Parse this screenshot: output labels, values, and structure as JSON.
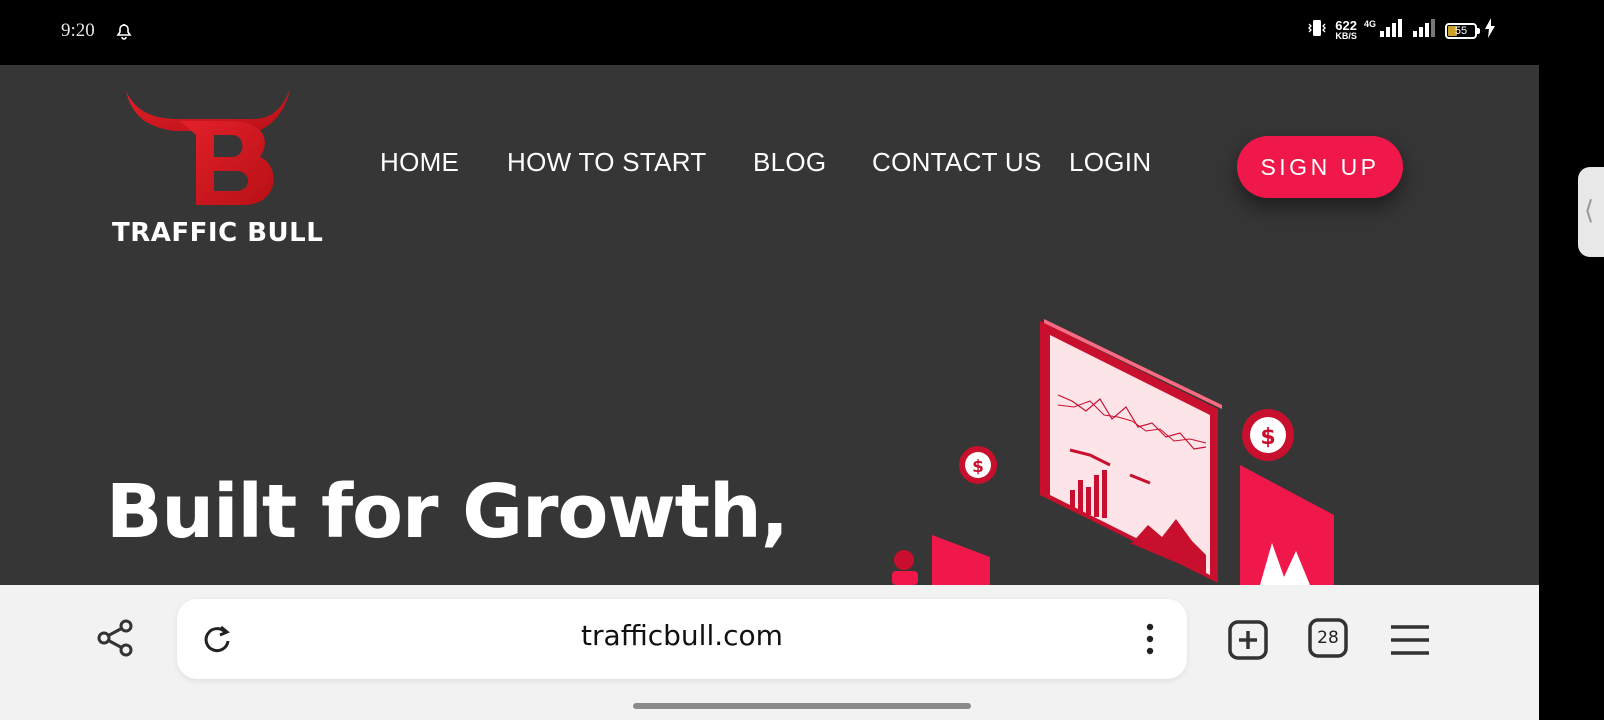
{
  "status_bar": {
    "time": "9:20",
    "net_rate": "622",
    "net_unit": "KB/S",
    "network": "4G",
    "battery": "55",
    "icons": [
      "alarm-icon",
      "vibrate-icon",
      "signal-icon",
      "battery-icon",
      "charging-icon"
    ]
  },
  "site": {
    "logo_text": "TRAFFIC BULL",
    "nav": {
      "home": "HOME",
      "how_to_start": "HOW TO START",
      "blog": "BLOG",
      "contact": "CONTACT US",
      "login": "LOGIN"
    },
    "signup": "SIGN UP",
    "hero_title": "Built for Growth,",
    "colors": {
      "accent": "#f0174a",
      "background": "#363636",
      "logo_red": "#d0161f"
    }
  },
  "browser": {
    "url": "trafficbull.com",
    "tab_count": "28",
    "icons": [
      "share-icon",
      "reload-icon",
      "more-vert-icon",
      "new-tab-icon",
      "tabs-icon",
      "menu-icon"
    ]
  }
}
